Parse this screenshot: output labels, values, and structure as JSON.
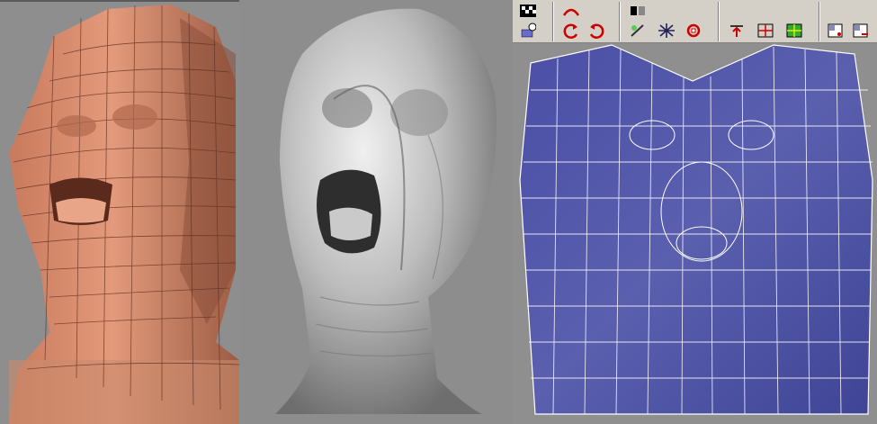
{
  "viewports": [
    {
      "name": "lowpoly-head",
      "color": "#d98c6e"
    },
    {
      "name": "sculpted-head",
      "color": "#c8c8c8"
    },
    {
      "name": "uv-layout",
      "color": "#4a4a9e"
    }
  ],
  "toolbar": {
    "background": "#d4d0c8",
    "icons": [
      "checker-icon",
      "select-vertex-icon",
      "rotate-ccw-icon",
      "rotate-cw-icon",
      "mirror-icon",
      "flip-icon",
      "weld-icon",
      "break-icon",
      "move-up-icon",
      "align-icon",
      "snap-icon",
      "grid-icon",
      "zoom-region-icon",
      "zoom-out-icon"
    ]
  }
}
